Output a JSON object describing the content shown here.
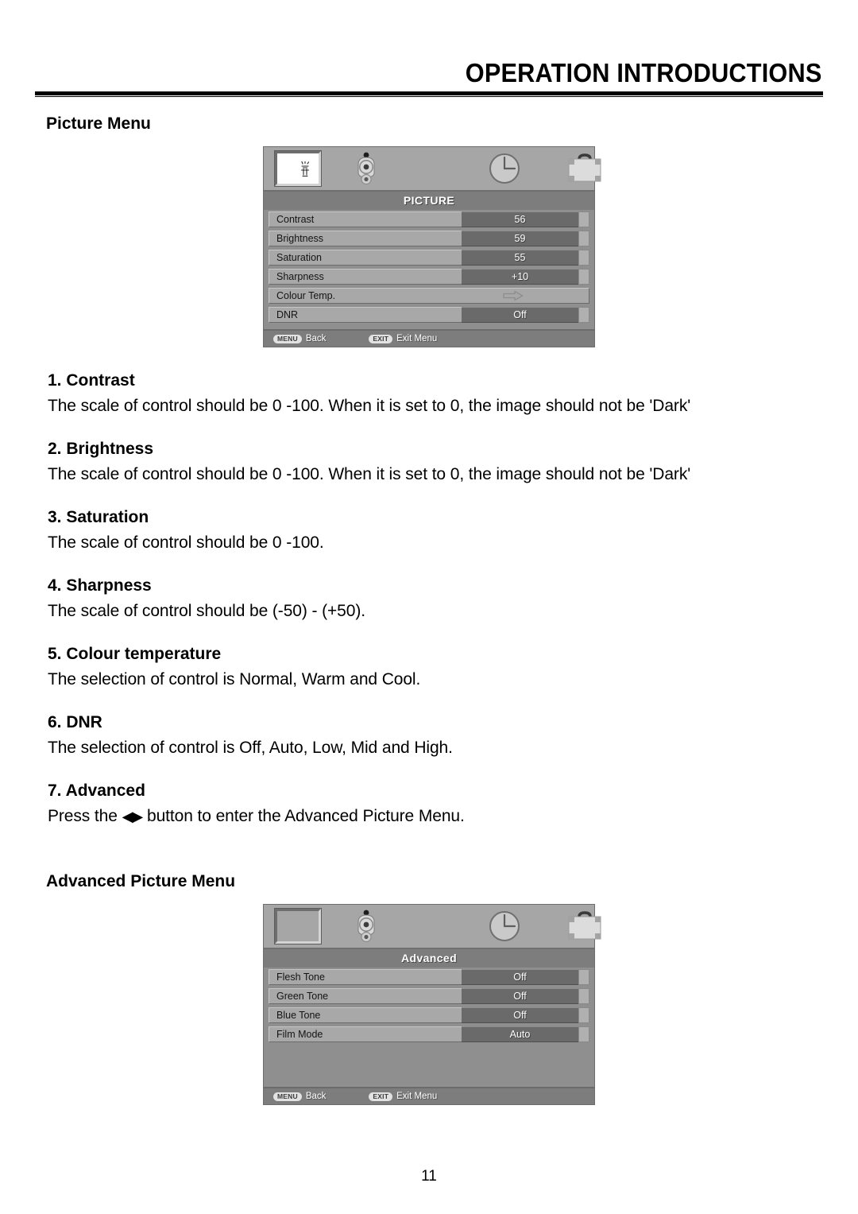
{
  "header": {
    "title": "OPERATION INTRODUCTIONS"
  },
  "sections": {
    "picture_menu_heading": "Picture Menu",
    "advanced_menu_heading": "Advanced Picture Menu"
  },
  "items": [
    {
      "heading": "1. Contrast",
      "body": "The scale of control should be 0 -100. When it is set to 0, the image should not be 'Dark'"
    },
    {
      "heading": "2. Brightness",
      "body": "The scale of control should be 0 -100. When it is set to 0, the image should not be 'Dark'"
    },
    {
      "heading": "3. Saturation",
      "body": "The scale of control should be 0 -100."
    },
    {
      "heading": "4. Sharpness",
      "body": "The scale of control should be (-50) - (+50)."
    },
    {
      "heading": "5. Colour temperature",
      "body": "The selection of control is Normal, Warm and Cool."
    },
    {
      "heading": "6. DNR",
      "body": "The selection of control is Off, Auto, Low, Mid and High."
    },
    {
      "heading": "7. Advanced",
      "body_before": "Press the",
      "arrows": "◀▶",
      "body_after": "button to enter the Advanced Picture Menu."
    }
  ],
  "picture_osd": {
    "title": "PICTURE",
    "tabs": [
      {
        "name": "picture-tab",
        "icon": "picture-icon",
        "selected": true
      },
      {
        "name": "audio-tab",
        "icon": "speaker-icon",
        "selected": false
      },
      {
        "name": "time-tab",
        "icon": "clock-icon",
        "selected": false
      },
      {
        "name": "setup-tab",
        "icon": "briefcase-icon",
        "selected": false
      }
    ],
    "rows": [
      {
        "label": "Contrast",
        "value": "56",
        "type": "value"
      },
      {
        "label": "Brightness",
        "value": "59",
        "type": "value"
      },
      {
        "label": "Saturation",
        "value": "55",
        "type": "value"
      },
      {
        "label": "Sharpness",
        "value": "+10",
        "type": "value"
      },
      {
        "label": "Colour Temp.",
        "value": "",
        "type": "submenu"
      },
      {
        "label": "DNR",
        "value": "Off",
        "type": "value"
      }
    ],
    "footer": {
      "back_key": "MENU",
      "back_label": "Back",
      "exit_key": "EXIT",
      "exit_label": "Exit Menu"
    }
  },
  "advanced_osd": {
    "title": "Advanced",
    "tabs": [
      {
        "name": "picture-tab",
        "icon": "picture-icon",
        "selected": true
      },
      {
        "name": "audio-tab",
        "icon": "speaker-icon",
        "selected": false
      },
      {
        "name": "time-tab",
        "icon": "clock-icon",
        "selected": false
      },
      {
        "name": "setup-tab",
        "icon": "briefcase-icon",
        "selected": false
      }
    ],
    "rows": [
      {
        "label": "Flesh Tone",
        "value": "Off",
        "type": "value"
      },
      {
        "label": "Green Tone",
        "value": "Off",
        "type": "value"
      },
      {
        "label": "Blue Tone",
        "value": "Off",
        "type": "value"
      },
      {
        "label": "Film Mode",
        "value": "Auto",
        "type": "value"
      }
    ],
    "footer": {
      "back_key": "MENU",
      "back_label": "Back",
      "exit_key": "EXIT",
      "exit_label": "Exit Menu"
    }
  },
  "page_number": "11",
  "colors": {
    "osd_panel": "#8f8f8f",
    "osd_tabbar": "#a6a6a6",
    "osd_title_bar": "#7d7d7d",
    "row_label": "#a8a8a8",
    "row_value": "#6a6a6a",
    "row_cap": "#b0b0b0"
  }
}
